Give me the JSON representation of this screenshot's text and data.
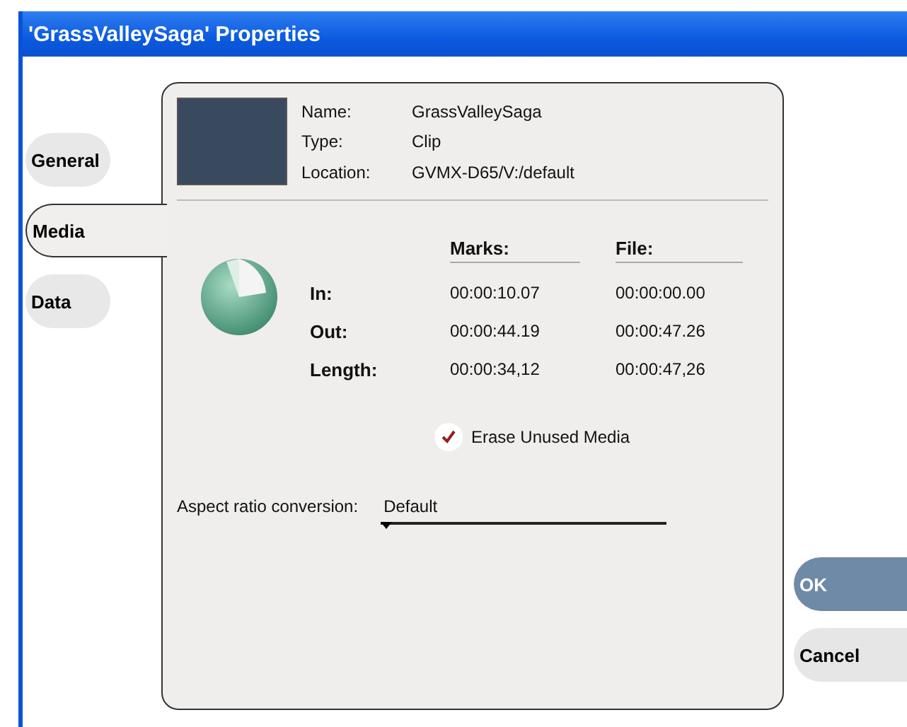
{
  "window": {
    "title": "'GrassValleySaga' Properties"
  },
  "tabs": [
    {
      "label": "General",
      "selected": false
    },
    {
      "label": "Media",
      "selected": true
    },
    {
      "label": "Data",
      "selected": false
    }
  ],
  "clip_info": [
    {
      "label": "Name:",
      "value": "GrassValleySaga"
    },
    {
      "label": "Type:",
      "value": "Clip"
    },
    {
      "label": "Location:",
      "value": "GVMX-D65/V:/default"
    }
  ],
  "timecodes": {
    "columns": [
      "Marks:",
      "File:"
    ],
    "rows": [
      {
        "label": "In:",
        "marks": "00:00:10.07",
        "file": "00:00:00.00"
      },
      {
        "label": "Out:",
        "marks": "00:00:44.19",
        "file": "00:00:47.26"
      },
      {
        "label": "Length:",
        "marks": "00:00:34,12",
        "file": "00:00:47,26"
      }
    ]
  },
  "erase_unused_media": {
    "label": "Erase Unused Media",
    "checked": true
  },
  "aspect_ratio": {
    "label": "Aspect ratio conversion:",
    "value": "Default"
  },
  "buttons": [
    {
      "label": "OK",
      "kind": "primary"
    },
    {
      "label": "Cancel",
      "kind": "secondary"
    }
  ]
}
